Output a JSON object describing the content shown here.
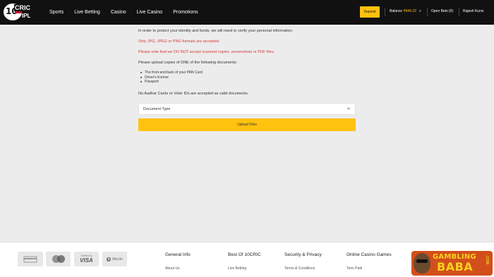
{
  "header": {
    "logo": {
      "number": "10",
      "brand": "CRIC",
      "badge": "IPL"
    },
    "nav": [
      "Sports",
      "Live Betting",
      "Casino",
      "Live Casino",
      "Promotions"
    ],
    "deposit_label": "Deposit",
    "balance_label": "Balance",
    "balance_amount": "₹946.22",
    "open_bets": "Open Bets (0)",
    "user_name": "Rajesh Kurra"
  },
  "verification": {
    "intro": "In order to protect your identity and funds, we will need to verify your personal information.",
    "formats_note": "Only JPG, JPEG or PNG formats are accepted.",
    "no_scans_note": "Please note that we DO NOT accept scanned copies, screenshots or PDF files.",
    "upload_instruction": "Please upload copies of ONE of the following documents:",
    "documents": [
      "The front and back of your PAN Card",
      "Driver's license",
      "Passport"
    ],
    "invalid_note": "No Aadhar Cards or Voter IDs are accepted as valid documents.",
    "document_type_select": "Document Type",
    "upload_button": "Upload Files"
  },
  "footer": {
    "payments": {
      "visa_top": "Verified by",
      "visa": "VISA",
      "bitcoin": "bitcoin"
    },
    "columns": [
      {
        "heading": "General Info",
        "link": "About Us"
      },
      {
        "heading": "Best Of 10CRIC",
        "link": "Live Betting"
      },
      {
        "heading": "Security & Privacy",
        "link": "Terms & Conditions"
      },
      {
        "heading": "Online Casino Games",
        "link": "Teen Patti"
      }
    ]
  },
  "watermark": {
    "line1": "GAMBLING",
    "line2": "BABA",
    "domain": ".COM"
  },
  "colors": {
    "accent": "#ffc20e",
    "topbar": "#111111",
    "warning_text": "#d23b3b",
    "page_bg": "#ececec"
  }
}
